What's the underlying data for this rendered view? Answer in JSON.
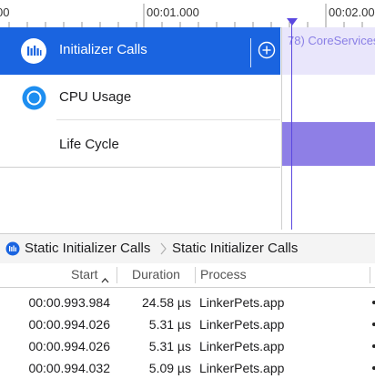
{
  "ruler": {
    "labels": [
      "00:01.000",
      "00:02.00"
    ]
  },
  "tracks": [
    {
      "label": "Initializer Calls",
      "icon": "bar-chart-icon"
    },
    {
      "label": "CPU Usage",
      "icon": "cpu-gauge-icon"
    },
    {
      "label": "Life Cycle",
      "icon": ""
    }
  ],
  "lane": {
    "initializer_text": "78)  CoreServices"
  },
  "breadcrumb": {
    "items": [
      "Static Initializer Calls",
      "Static Initializer Calls"
    ]
  },
  "table": {
    "columns": [
      "Start",
      "Duration",
      "Process"
    ],
    "sort_indicator": "^",
    "rows": [
      {
        "start": "00:00.993.984",
        "duration": "24.58 µs",
        "process": "LinkerPets.app"
      },
      {
        "start": "00:00.994.026",
        "duration": "5.31 µs",
        "process": "LinkerPets.app"
      },
      {
        "start": "00:00.994.026",
        "duration": "5.31 µs",
        "process": "LinkerPets.app"
      },
      {
        "start": "00:00.994.032",
        "duration": "5.09 µs",
        "process": "LinkerPets.app"
      }
    ]
  },
  "colors": {
    "accent": "#1a64e0",
    "lifecycle": "#8e7fe6",
    "playhead": "#5b48e0"
  }
}
